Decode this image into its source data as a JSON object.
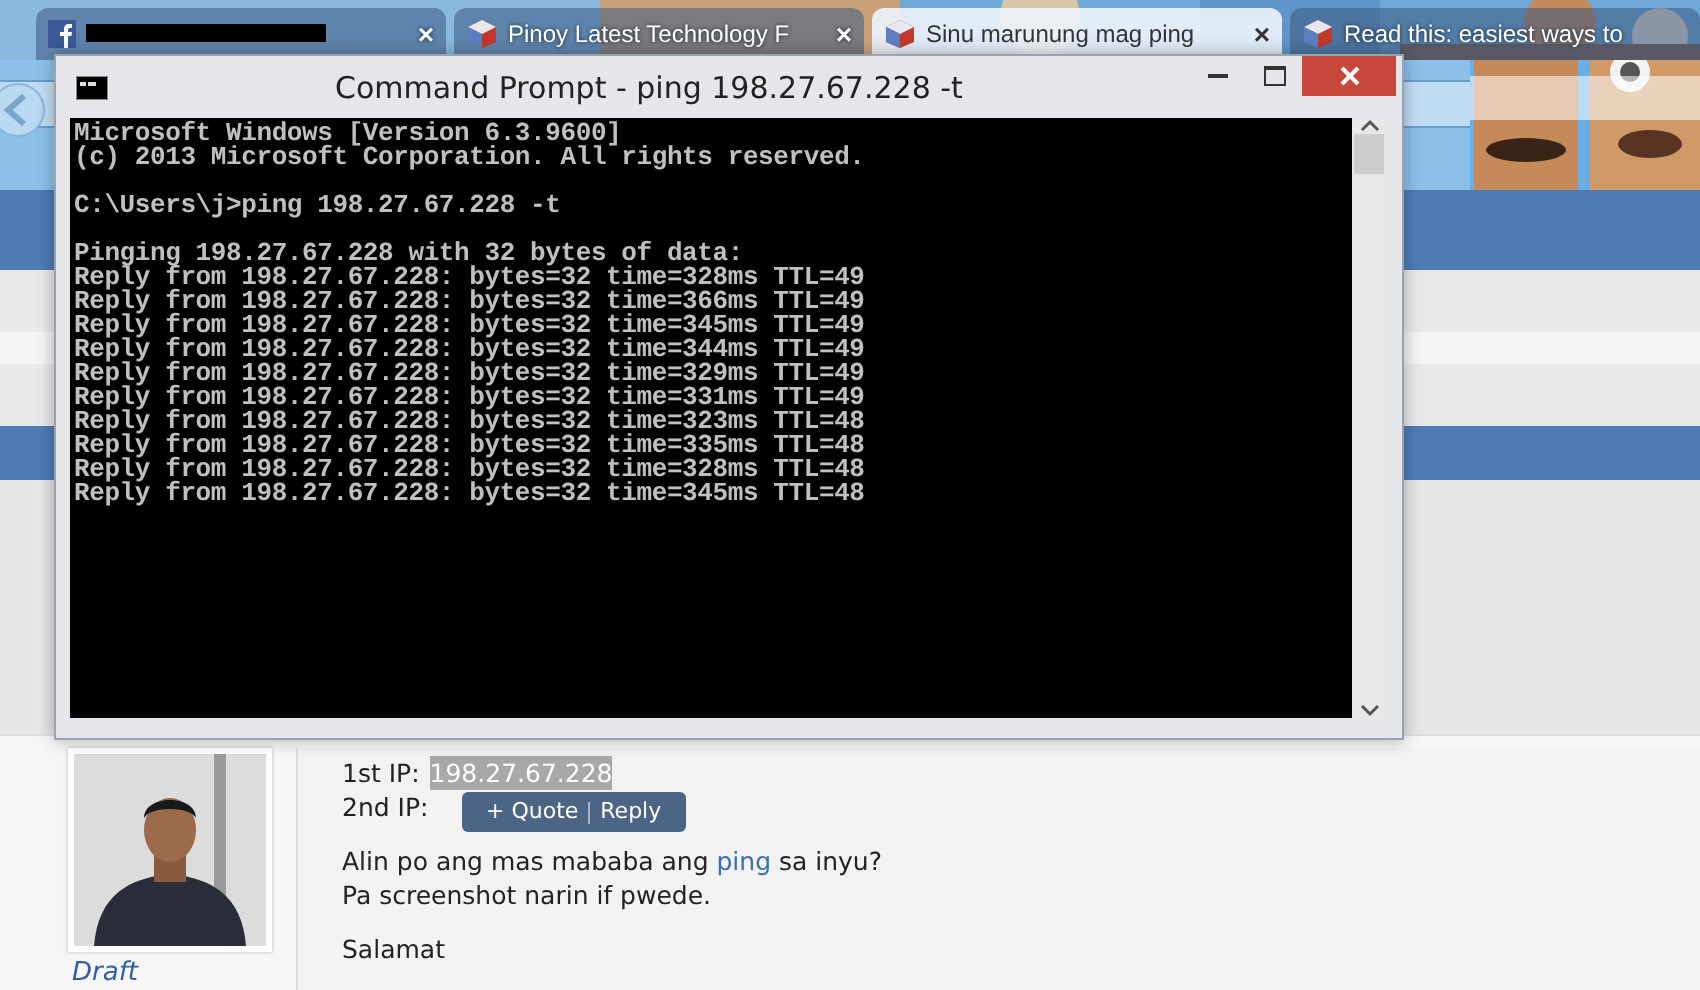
{
  "browser": {
    "tabs": [
      {
        "kind": "redacted",
        "close": "×",
        "selected": false
      },
      {
        "kind": "page",
        "title": "Pinoy Latest Technology F",
        "close": "×",
        "selected": false
      },
      {
        "kind": "page",
        "title": "Sinu marunung mag ping",
        "close": "×",
        "selected": true
      },
      {
        "kind": "page",
        "title": "Read this: easiest ways to",
        "selected": false
      }
    ]
  },
  "console_window": {
    "title": "Command Prompt - ping  198.27.67.228 -t",
    "blocks": [
      [
        "Microsoft Windows [Version 6.3.9600]",
        "(c) 2013 Microsoft Corporation. All rights reserved."
      ],
      [
        "C:\\Users\\j>ping 198.27.67.228 -t"
      ],
      [
        "Pinging 198.27.67.228 with 32 bytes of data:",
        "Reply from 198.27.67.228: bytes=32 time=328ms TTL=49",
        "Reply from 198.27.67.228: bytes=32 time=366ms TTL=49",
        "Reply from 198.27.67.228: bytes=32 time=345ms TTL=49",
        "Reply from 198.27.67.228: bytes=32 time=344ms TTL=49",
        "Reply from 198.27.67.228: bytes=32 time=329ms TTL=49",
        "Reply from 198.27.67.228: bytes=32 time=331ms TTL=49",
        "Reply from 198.27.67.228: bytes=32 time=323ms TTL=48",
        "Reply from 198.27.67.228: bytes=32 time=335ms TTL=48",
        "Reply from 198.27.67.228: bytes=32 time=328ms TTL=48",
        "Reply from 198.27.67.228: bytes=32 time=345ms TTL=48"
      ]
    ]
  },
  "post": {
    "author": "Draft",
    "ip_lines": [
      {
        "label": "1st IP:",
        "value": "198.27.67.228",
        "selected": true
      },
      {
        "label": "2nd IP:"
      }
    ],
    "tooltip": {
      "quote": "+ Quote",
      "reply": "Reply"
    },
    "question": {
      "before": "Alin po ang mas mababa ang",
      "link": "ping",
      "after": "sa inyu?"
    },
    "paragraphs": [
      "Pa screenshot narin if pwede.",
      "Salamat"
    ]
  }
}
